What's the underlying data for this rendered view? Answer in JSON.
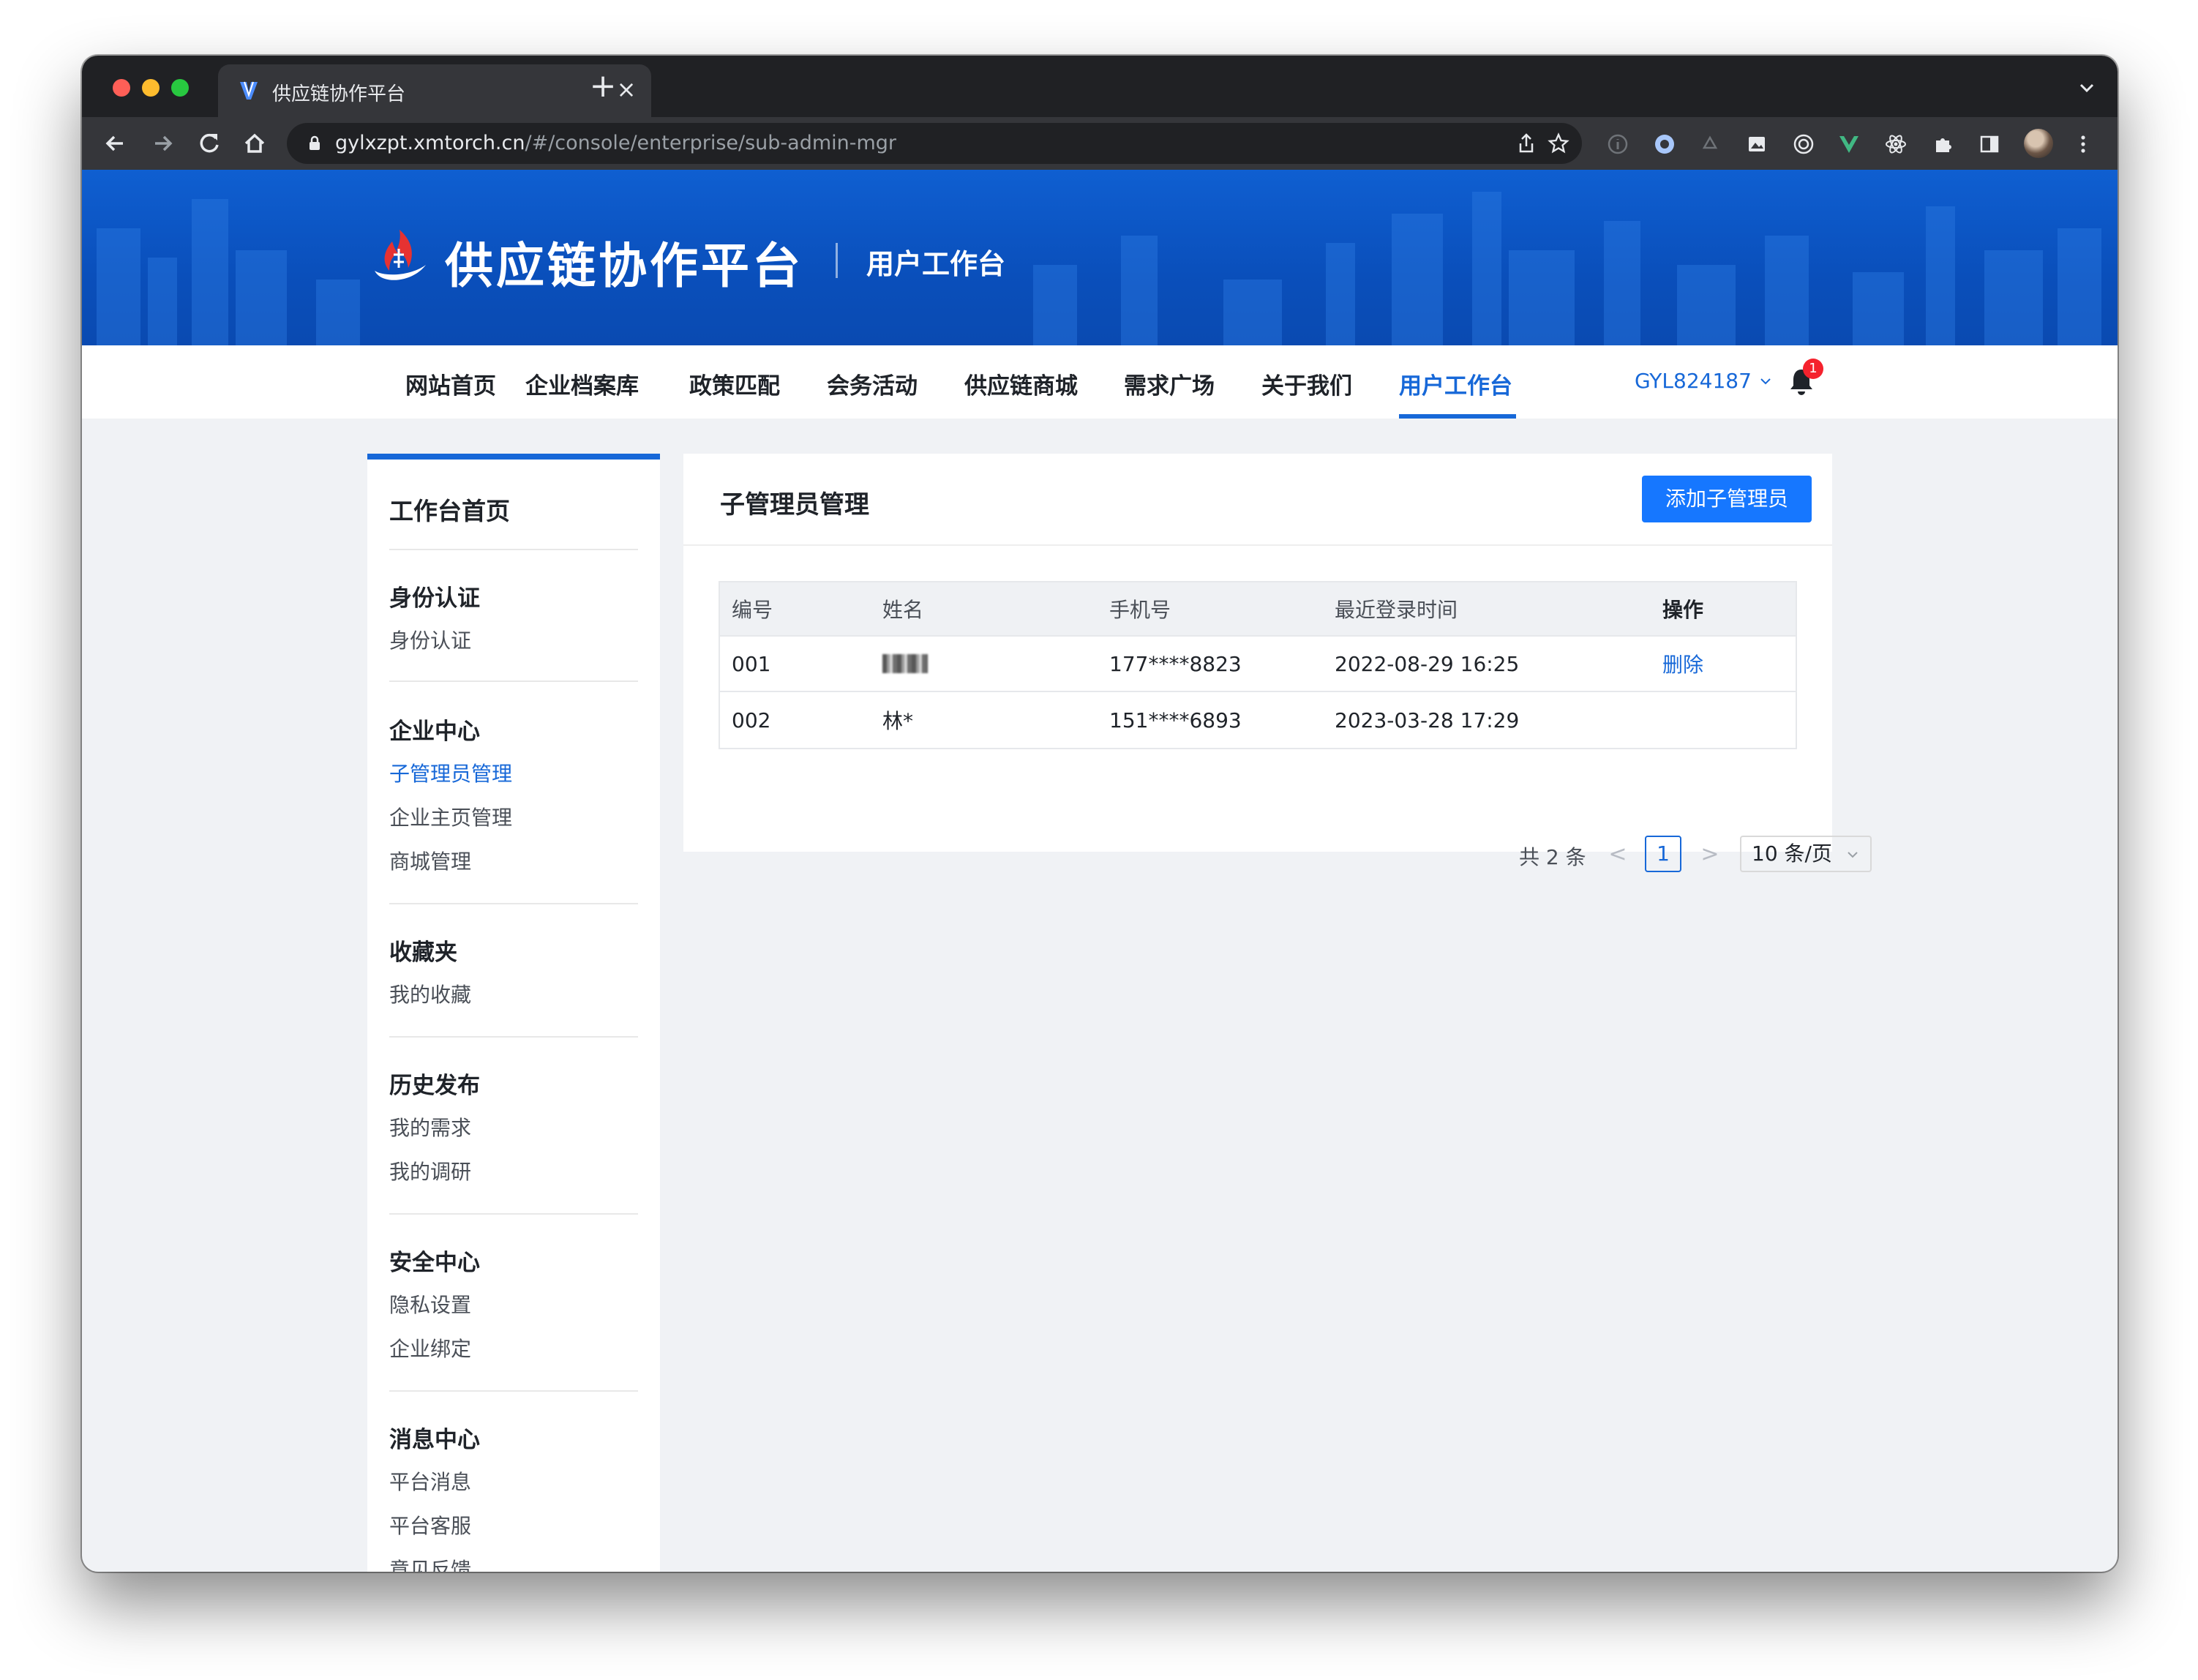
{
  "browser": {
    "tab_title": "供应链协作平台",
    "tab_close": "×",
    "new_tab": "+",
    "url_host": "gylxzpt.xmtorch.cn",
    "url_path": "/#/console/enterprise/sub-admin-mgr"
  },
  "site": {
    "title": "供应链协作平台",
    "subtitle": "用户工作台",
    "brand_color": "#1768d8"
  },
  "nav": {
    "items": [
      {
        "label": "网站首页",
        "active": false
      },
      {
        "label": "企业档案库",
        "active": false
      },
      {
        "label": "政策匹配",
        "active": false
      },
      {
        "label": "会务活动",
        "active": false
      },
      {
        "label": "供应链商城",
        "active": false
      },
      {
        "label": "需求广场",
        "active": false
      },
      {
        "label": "关于我们",
        "active": false
      },
      {
        "label": "用户工作台",
        "active": true
      }
    ],
    "user": "GYL824187",
    "notification_count": "1"
  },
  "sidebar": {
    "home": "工作台首页",
    "sections": [
      {
        "title": "身份认证",
        "links": [
          "身份认证"
        ]
      },
      {
        "title": "企业中心",
        "links": [
          "子管理员管理",
          "企业主页管理",
          "商城管理"
        ],
        "active_link": "子管理员管理"
      },
      {
        "title": "收藏夹",
        "links": [
          "我的收藏"
        ]
      },
      {
        "title": "历史发布",
        "links": [
          "我的需求",
          "我的调研"
        ]
      },
      {
        "title": "安全中心",
        "links": [
          "隐私设置",
          "企业绑定"
        ]
      },
      {
        "title": "消息中心",
        "links": [
          "平台消息",
          "平台客服",
          "意见反馈"
        ]
      }
    ]
  },
  "main": {
    "title": "子管理员管理",
    "add_button": "添加子管理员",
    "table": {
      "headers": [
        "编号",
        "姓名",
        "手机号",
        "最近登录时间",
        "操作"
      ],
      "rows": [
        {
          "id": "001",
          "name": "",
          "name_redacted": true,
          "phone": "177****8823",
          "last_login": "2022-08-29 16:25",
          "action": "删除"
        },
        {
          "id": "002",
          "name": "林*",
          "name_redacted": false,
          "phone": "151****6893",
          "last_login": "2023-03-28 17:29",
          "action": ""
        }
      ]
    },
    "pagination": {
      "total": "共 2 条",
      "prev": "<",
      "current_page": "1",
      "next": ">",
      "page_size": "10 条/页"
    }
  }
}
